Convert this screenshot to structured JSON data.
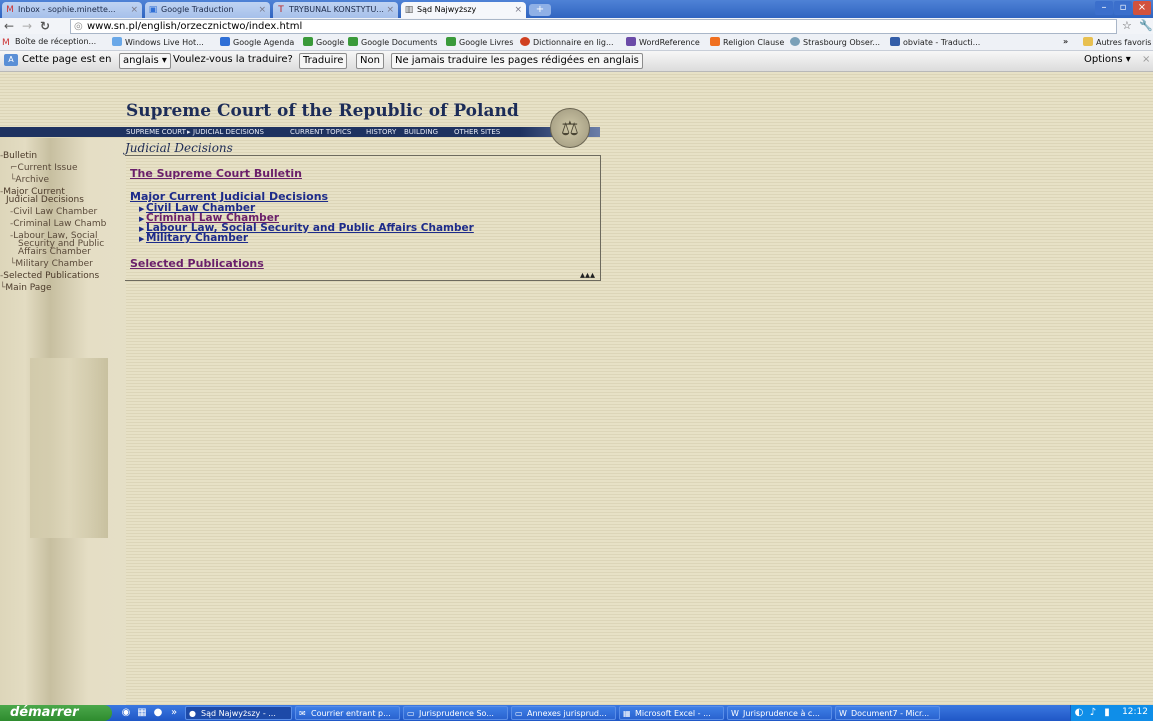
{
  "browser": {
    "tabs": [
      {
        "title": "Inbox - sophie.minette...",
        "icon": "gmail-icon",
        "active": false
      },
      {
        "title": "Google Traduction",
        "icon": "google-translate-icon",
        "active": false
      },
      {
        "title": "TRYBUNAL KONSTYTU...",
        "icon": "tribunal-icon",
        "active": false
      },
      {
        "title": "Sąd Najwyższy",
        "icon": "page-icon",
        "active": true
      }
    ],
    "url": "www.sn.pl/english/orzecznictwo/index.html",
    "bookmarks": [
      "Boîte de réception...",
      "Windows Live Hot...",
      "Google Agenda",
      "Google",
      "Google Documents",
      "Google Livres",
      "Dictionnaire en lig...",
      "WordReference",
      "Religion Clause",
      "Strasbourg Obser...",
      "obviate - Traducti..."
    ],
    "other_bookmarks": "Autres favoris",
    "translate": {
      "prefix": "Cette page est en",
      "language": "anglais",
      "question": "Voulez-vous la traduire?",
      "translate_btn": "Traduire",
      "no_btn": "Non",
      "never_btn": "Ne jamais traduire les pages rédigées en anglais",
      "options": "Options"
    }
  },
  "site": {
    "title": "Supreme Court of the Republic of Poland",
    "nav": [
      "SUPREME COURT",
      "JUDICIAL DECISIONS",
      "CURRENT TOPICS",
      "HISTORY",
      "BUILDING",
      "OTHER SITES"
    ],
    "side_menu": [
      "Bulletin",
      "Current Issue",
      "Archive",
      "Major Current",
      "Judicial Decisions",
      "Civil Law Chamber",
      "Criminal Law Chamb",
      "Labour Law, Social",
      "Security and Public",
      "Affairs Chamber",
      "Military Chamber",
      "Selected Publications",
      "Main Page"
    ],
    "breadcrumb": "Judicial Decisions",
    "content": {
      "bulletin_link": "The Supreme Court Bulletin",
      "major_link": "Major Current Judicial Decisions",
      "chambers": [
        "Civil Law Chamber",
        "Criminal Law Chamber",
        "Labour Law, Social Security and Public Affairs Chamber",
        "Military Chamber"
      ],
      "publications_link": "Selected Publications"
    }
  },
  "taskbar": {
    "start": "démarrer",
    "tasks": [
      "Sąd Najwyższy - ...",
      "Courrier entrant p...",
      "Jurisprudence So...",
      "Annexes jurisprud...",
      "Microsoft Excel - ...",
      "Jurisprudence à c...",
      "Document7 - Micr..."
    ],
    "clock": "12:12"
  }
}
